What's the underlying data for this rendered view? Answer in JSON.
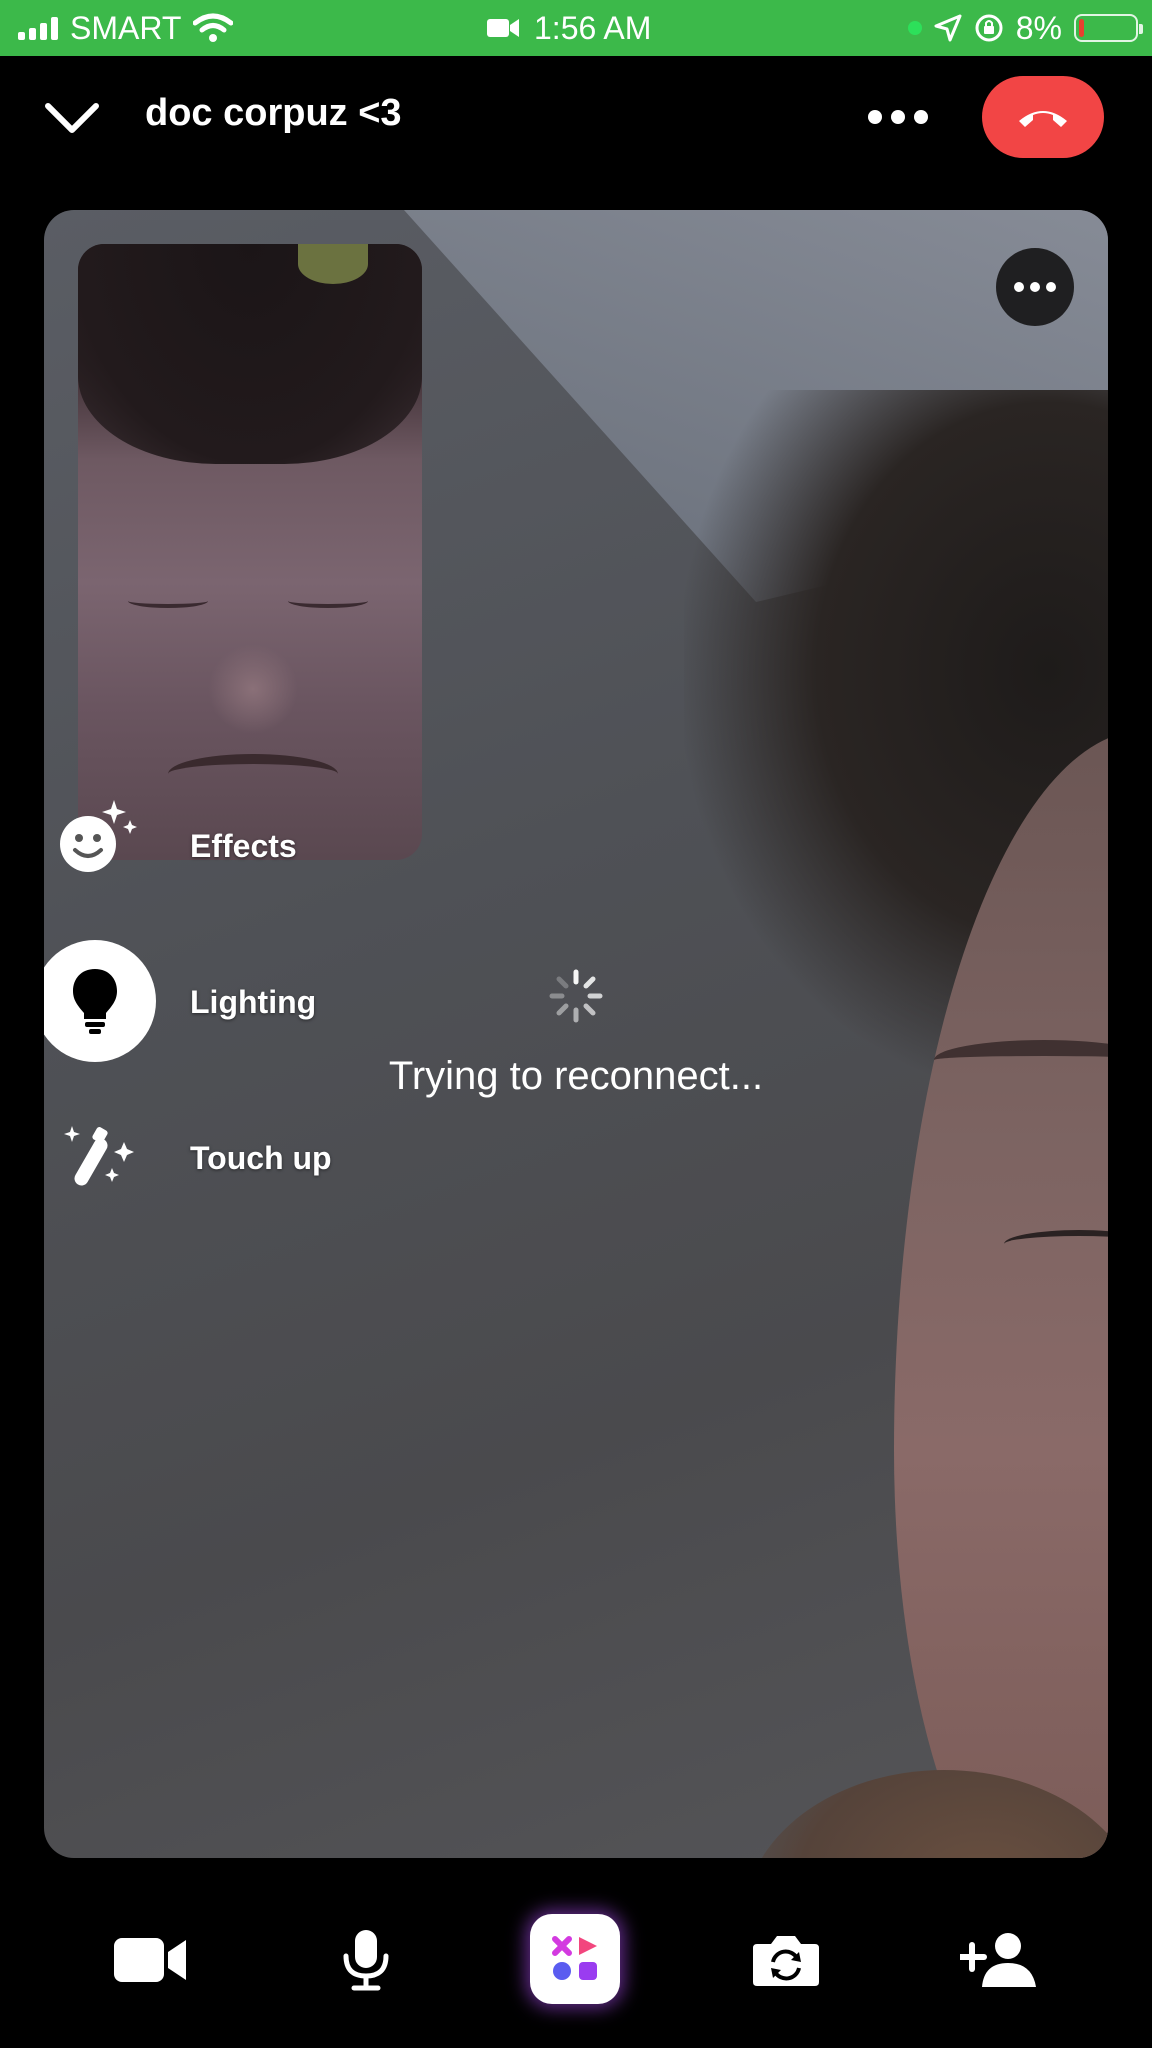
{
  "status_bar": {
    "carrier": "SMART",
    "time": "1:56 AM",
    "battery_percent": "8%",
    "battery_level": 0.08,
    "icons": [
      "signal-icon",
      "wifi-icon",
      "video-indicator-icon",
      "location-icon",
      "orientation-lock-icon",
      "battery-icon"
    ]
  },
  "header": {
    "contact_name": "doc corpuz <3",
    "collapse_icon": "chevron-down-icon",
    "more_icon": "more-icon",
    "end_call_icon": "end-call-icon"
  },
  "effects_menu": {
    "items": [
      {
        "label": "Effects",
        "icon": "effects-icon",
        "selected": false
      },
      {
        "label": "Lighting",
        "icon": "lightbulb-icon",
        "selected": true
      },
      {
        "label": "Touch up",
        "icon": "touch-up-wand-icon",
        "selected": false
      }
    ]
  },
  "call_status": {
    "text": "Trying to reconnect..."
  },
  "bottom_bar": {
    "buttons": [
      {
        "name": "camera",
        "icon": "video-camera-icon"
      },
      {
        "name": "microphone",
        "icon": "microphone-icon"
      },
      {
        "name": "apps",
        "icon": "apps-icon"
      },
      {
        "name": "flip-camera",
        "icon": "flip-camera-icon"
      },
      {
        "name": "add-person",
        "icon": "add-person-icon"
      }
    ]
  },
  "colors": {
    "status_bar_bg": "#3cb94a",
    "end_call": "#f24545",
    "apps_glow": "#b450ff"
  }
}
